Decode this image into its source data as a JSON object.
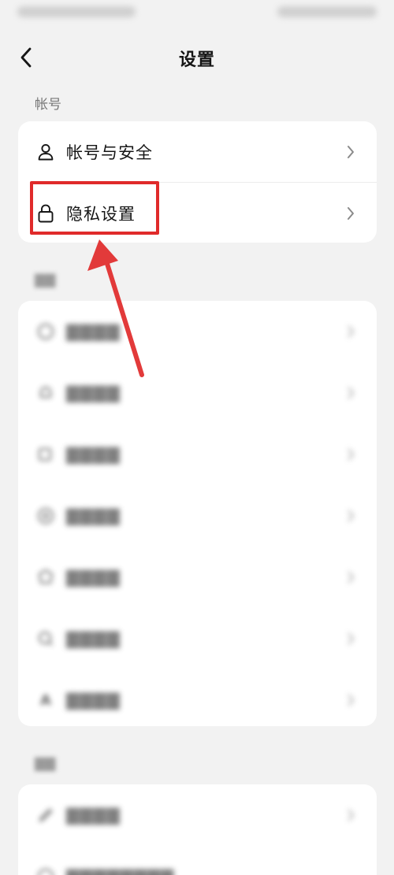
{
  "header": {
    "title": "设置",
    "back_icon": "chevron-left-icon"
  },
  "account_section": {
    "label": "帐号",
    "items": [
      {
        "label": "帐号与安全",
        "icon": "person-icon"
      },
      {
        "label": "隐私设置",
        "icon": "lock-icon"
      }
    ]
  },
  "colors": {
    "background": "#f2f2f2",
    "card": "#ffffff",
    "highlight": "#e02a2a",
    "text": "#161616",
    "section_label": "#777777"
  }
}
